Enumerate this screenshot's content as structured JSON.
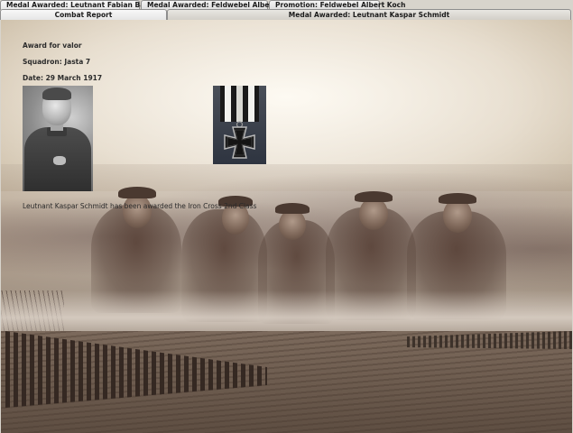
{
  "tabs_top": [
    {
      "label": "Medal Awarded: Leutnant Fabian Baerwald"
    },
    {
      "label": "Medal Awarded: Feldwebel Albert Koch"
    },
    {
      "label": "Promotion: Feldwebel Albert Koch"
    }
  ],
  "tabs_bottom": [
    {
      "label": "Combat Report"
    },
    {
      "label": "Medal Awarded: Leutnant Kaspar Schmidt",
      "selected": true
    }
  ],
  "report": {
    "award_line": "Award for valor",
    "squadron_line": "Squadron: Jasta 7",
    "date_line": "Date: 29 March 1917",
    "message": "Leutnant Kaspar Schmidt has been awarded the Iron Cross 2nd Class"
  },
  "colors": {
    "ribbon_white": "#f2f2ee",
    "ribbon_black": "#1a1a1a",
    "cross_dark": "#151515",
    "cross_border": "#b8b8b8"
  },
  "icons": {
    "medal": "iron-cross-icon",
    "portrait": "pilot-portrait"
  }
}
